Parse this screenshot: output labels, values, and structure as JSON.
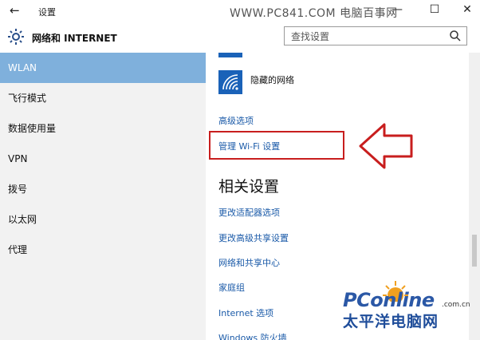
{
  "window": {
    "back_glyph": "←",
    "title": "设置",
    "watermark": "WWW.PC841.COM 电脑百事网",
    "minimize_glyph": "—",
    "maximize_glyph": "☐",
    "close_glyph": "✕"
  },
  "header": {
    "title": "网络和 INTERNET",
    "search_placeholder": "查找设置"
  },
  "sidebar": {
    "items": [
      {
        "label": "WLAN"
      },
      {
        "label": "飞行模式"
      },
      {
        "label": "数据使用量"
      },
      {
        "label": "VPN"
      },
      {
        "label": "拨号"
      },
      {
        "label": "以太网"
      },
      {
        "label": "代理"
      }
    ],
    "active_index": 0
  },
  "content": {
    "hidden_network": "隐藏的网络",
    "advanced_options": "高级选项",
    "manage_wifi": "管理 Wi-Fi 设置",
    "related_heading": "相关设置",
    "related_links": [
      "更改适配器选项",
      "更改高级共享设置",
      "网络和共享中心",
      "家庭组",
      "Internet 选项",
      "Windows 防火墙"
    ]
  },
  "logo": {
    "brand": "PConline",
    "domain": ".com.cn",
    "chinese": "太平洋电脑网"
  },
  "colors": {
    "accent": "#7fb0dc",
    "link": "#1a5aa8",
    "tile": "#1a62b8",
    "annotation_red": "#c81e1e"
  },
  "icons": [
    "back-arrow-icon",
    "gear-icon",
    "search-icon",
    "wifi-icon",
    "annotation-arrow-icon"
  ]
}
